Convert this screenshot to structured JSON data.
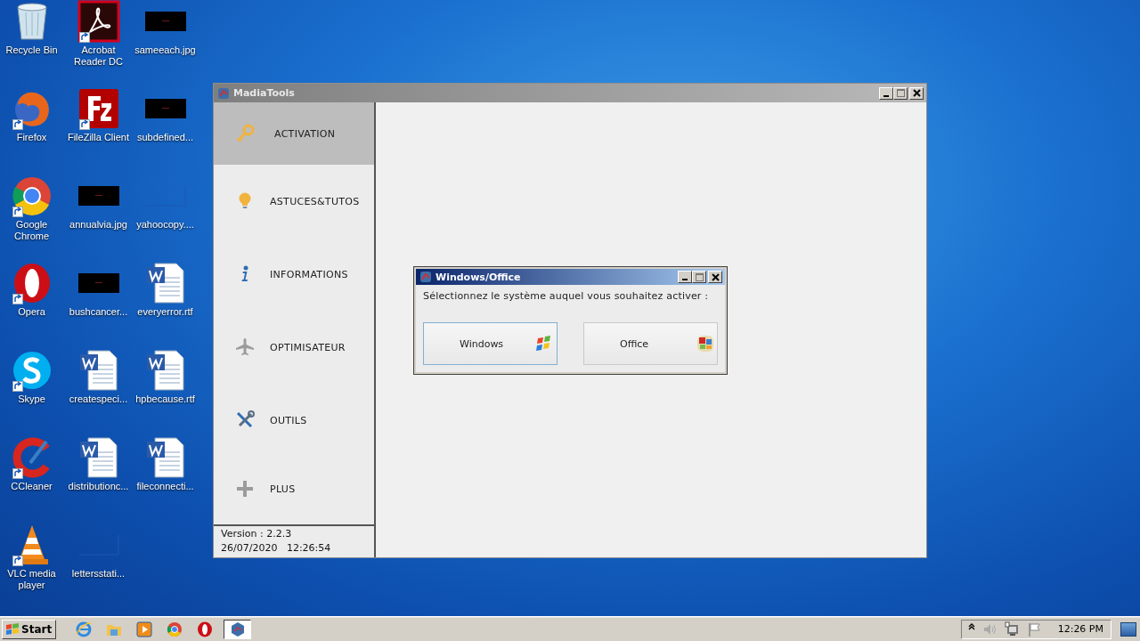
{
  "desktop": {
    "icons": [
      {
        "label": "Recycle Bin",
        "kind": "recycle-bin",
        "shortcut": false
      },
      {
        "label": "Acrobat Reader DC",
        "kind": "acrobat",
        "shortcut": true
      },
      {
        "label": "sameeach.jpg",
        "kind": "image",
        "shortcut": false
      },
      {
        "label": "Firefox",
        "kind": "firefox",
        "shortcut": true
      },
      {
        "label": "FileZilla Client",
        "kind": "filezilla",
        "shortcut": true
      },
      {
        "label": "subdefined...",
        "kind": "image",
        "shortcut": false
      },
      {
        "label": "Google Chrome",
        "kind": "chrome",
        "shortcut": true
      },
      {
        "label": "annualvia.jpg",
        "kind": "image",
        "shortcut": false
      },
      {
        "label": "yahoocopy....",
        "kind": "blank",
        "shortcut": false
      },
      {
        "label": "Opera",
        "kind": "opera",
        "shortcut": true
      },
      {
        "label": "bushcancer...",
        "kind": "image",
        "shortcut": false
      },
      {
        "label": "everyerror.rtf",
        "kind": "word",
        "shortcut": false
      },
      {
        "label": "Skype",
        "kind": "skype",
        "shortcut": true
      },
      {
        "label": "createspeci...",
        "kind": "word",
        "shortcut": false
      },
      {
        "label": "hpbecause.rtf",
        "kind": "word",
        "shortcut": false
      },
      {
        "label": "CCleaner",
        "kind": "ccleaner",
        "shortcut": true
      },
      {
        "label": "distributionc...",
        "kind": "word",
        "shortcut": false
      },
      {
        "label": "fileconnecti...",
        "kind": "word",
        "shortcut": false
      },
      {
        "label": "VLC media player",
        "kind": "vlc",
        "shortcut": true
      },
      {
        "label": "lettersstati...",
        "kind": "blank",
        "shortcut": false
      }
    ]
  },
  "main_window": {
    "title": "MadiaTools",
    "active": false,
    "menu": [
      {
        "label": "ACTIVATION",
        "kind": "key",
        "selected": true
      },
      {
        "label": "ASTUCES&TUTOS",
        "kind": "bulb",
        "selected": false
      },
      {
        "label": "INFORMATIONS",
        "kind": "info",
        "selected": false
      },
      {
        "label": "OPTIMISATEUR",
        "kind": "plane",
        "selected": false
      },
      {
        "label": "OUTILS",
        "kind": "tools",
        "selected": false
      },
      {
        "label": "PLUS",
        "kind": "plus",
        "selected": false
      }
    ],
    "version": "Version : 2.2.3",
    "datetime": "26/07/2020   12:26:54"
  },
  "dialog": {
    "title": "Windows/Office",
    "active": true,
    "prompt": "Sélectionnez le système auquel vous souhaitez activer :",
    "buttons": [
      {
        "label": "Windows",
        "kind": "windows",
        "focused": true
      },
      {
        "label": "Office",
        "kind": "office",
        "focused": false
      }
    ]
  },
  "taskbar": {
    "start": "Start",
    "apps": [
      {
        "kind": "ie",
        "active": false
      },
      {
        "kind": "explorer",
        "active": false
      },
      {
        "kind": "media",
        "active": false
      },
      {
        "kind": "chrome",
        "active": false
      },
      {
        "kind": "opera",
        "active": false
      },
      {
        "kind": "madiatools",
        "active": true
      }
    ],
    "clock": "12:26 PM"
  }
}
